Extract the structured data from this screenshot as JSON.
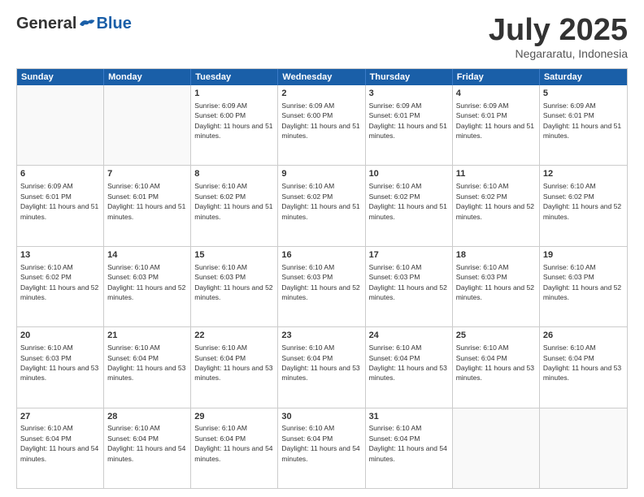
{
  "header": {
    "logo_general": "General",
    "logo_blue": "Blue",
    "month_title": "July 2025",
    "subtitle": "Negararatu, Indonesia"
  },
  "weekdays": [
    "Sunday",
    "Monday",
    "Tuesday",
    "Wednesday",
    "Thursday",
    "Friday",
    "Saturday"
  ],
  "rows": [
    [
      {
        "day": "",
        "empty": true
      },
      {
        "day": "",
        "empty": true
      },
      {
        "day": "1",
        "sunrise": "6:09 AM",
        "sunset": "6:00 PM",
        "daylight": "11 hours and 51 minutes."
      },
      {
        "day": "2",
        "sunrise": "6:09 AM",
        "sunset": "6:00 PM",
        "daylight": "11 hours and 51 minutes."
      },
      {
        "day": "3",
        "sunrise": "6:09 AM",
        "sunset": "6:01 PM",
        "daylight": "11 hours and 51 minutes."
      },
      {
        "day": "4",
        "sunrise": "6:09 AM",
        "sunset": "6:01 PM",
        "daylight": "11 hours and 51 minutes."
      },
      {
        "day": "5",
        "sunrise": "6:09 AM",
        "sunset": "6:01 PM",
        "daylight": "11 hours and 51 minutes."
      }
    ],
    [
      {
        "day": "6",
        "sunrise": "6:09 AM",
        "sunset": "6:01 PM",
        "daylight": "11 hours and 51 minutes."
      },
      {
        "day": "7",
        "sunrise": "6:10 AM",
        "sunset": "6:01 PM",
        "daylight": "11 hours and 51 minutes."
      },
      {
        "day": "8",
        "sunrise": "6:10 AM",
        "sunset": "6:02 PM",
        "daylight": "11 hours and 51 minutes."
      },
      {
        "day": "9",
        "sunrise": "6:10 AM",
        "sunset": "6:02 PM",
        "daylight": "11 hours and 51 minutes."
      },
      {
        "day": "10",
        "sunrise": "6:10 AM",
        "sunset": "6:02 PM",
        "daylight": "11 hours and 51 minutes."
      },
      {
        "day": "11",
        "sunrise": "6:10 AM",
        "sunset": "6:02 PM",
        "daylight": "11 hours and 52 minutes."
      },
      {
        "day": "12",
        "sunrise": "6:10 AM",
        "sunset": "6:02 PM",
        "daylight": "11 hours and 52 minutes."
      }
    ],
    [
      {
        "day": "13",
        "sunrise": "6:10 AM",
        "sunset": "6:02 PM",
        "daylight": "11 hours and 52 minutes."
      },
      {
        "day": "14",
        "sunrise": "6:10 AM",
        "sunset": "6:03 PM",
        "daylight": "11 hours and 52 minutes."
      },
      {
        "day": "15",
        "sunrise": "6:10 AM",
        "sunset": "6:03 PM",
        "daylight": "11 hours and 52 minutes."
      },
      {
        "day": "16",
        "sunrise": "6:10 AM",
        "sunset": "6:03 PM",
        "daylight": "11 hours and 52 minutes."
      },
      {
        "day": "17",
        "sunrise": "6:10 AM",
        "sunset": "6:03 PM",
        "daylight": "11 hours and 52 minutes."
      },
      {
        "day": "18",
        "sunrise": "6:10 AM",
        "sunset": "6:03 PM",
        "daylight": "11 hours and 52 minutes."
      },
      {
        "day": "19",
        "sunrise": "6:10 AM",
        "sunset": "6:03 PM",
        "daylight": "11 hours and 52 minutes."
      }
    ],
    [
      {
        "day": "20",
        "sunrise": "6:10 AM",
        "sunset": "6:03 PM",
        "daylight": "11 hours and 53 minutes."
      },
      {
        "day": "21",
        "sunrise": "6:10 AM",
        "sunset": "6:04 PM",
        "daylight": "11 hours and 53 minutes."
      },
      {
        "day": "22",
        "sunrise": "6:10 AM",
        "sunset": "6:04 PM",
        "daylight": "11 hours and 53 minutes."
      },
      {
        "day": "23",
        "sunrise": "6:10 AM",
        "sunset": "6:04 PM",
        "daylight": "11 hours and 53 minutes."
      },
      {
        "day": "24",
        "sunrise": "6:10 AM",
        "sunset": "6:04 PM",
        "daylight": "11 hours and 53 minutes."
      },
      {
        "day": "25",
        "sunrise": "6:10 AM",
        "sunset": "6:04 PM",
        "daylight": "11 hours and 53 minutes."
      },
      {
        "day": "26",
        "sunrise": "6:10 AM",
        "sunset": "6:04 PM",
        "daylight": "11 hours and 53 minutes."
      }
    ],
    [
      {
        "day": "27",
        "sunrise": "6:10 AM",
        "sunset": "6:04 PM",
        "daylight": "11 hours and 54 minutes."
      },
      {
        "day": "28",
        "sunrise": "6:10 AM",
        "sunset": "6:04 PM",
        "daylight": "11 hours and 54 minutes."
      },
      {
        "day": "29",
        "sunrise": "6:10 AM",
        "sunset": "6:04 PM",
        "daylight": "11 hours and 54 minutes."
      },
      {
        "day": "30",
        "sunrise": "6:10 AM",
        "sunset": "6:04 PM",
        "daylight": "11 hours and 54 minutes."
      },
      {
        "day": "31",
        "sunrise": "6:10 AM",
        "sunset": "6:04 PM",
        "daylight": "11 hours and 54 minutes."
      },
      {
        "day": "",
        "empty": true
      },
      {
        "day": "",
        "empty": true
      }
    ]
  ]
}
